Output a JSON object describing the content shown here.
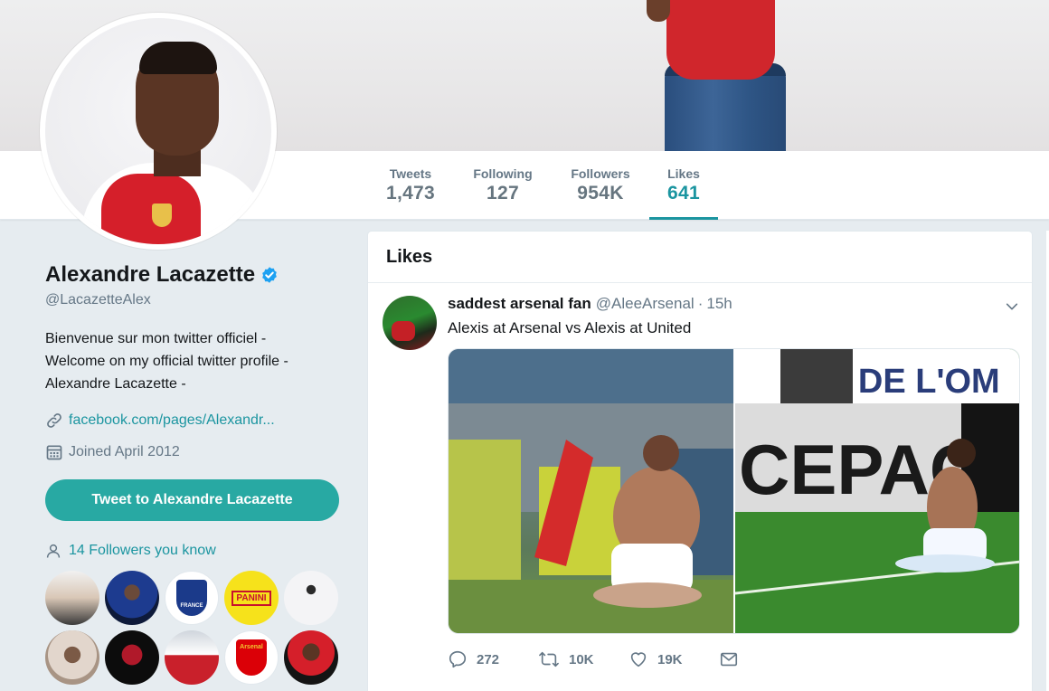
{
  "profile": {
    "name": "Alexandre Lacazette",
    "handle": "@LacazetteAlex",
    "bio": [
      "Bienvenue sur mon twitter officiel -",
      "Welcome on my official twitter profile -",
      "Alexandre Lacazette -"
    ],
    "link": "facebook.com/pages/Alexandr...",
    "joined": "Joined April 2012",
    "tweet_to_button": "Tweet to Alexandre Lacazette",
    "followers_you_know": "14 Followers you know"
  },
  "nav": {
    "stats": [
      {
        "label": "Tweets",
        "value": "1,473",
        "active": false
      },
      {
        "label": "Following",
        "value": "127",
        "active": false
      },
      {
        "label": "Followers",
        "value": "954K",
        "active": false
      },
      {
        "label": "Likes",
        "value": "641",
        "active": true
      }
    ]
  },
  "timeline": {
    "title": "Likes",
    "tweet": {
      "name": "saddest arsenal fan",
      "handle": "@AleeArsenal",
      "dot": "·",
      "time": "15h",
      "text": "Alexis at Arsenal vs Alexis at United",
      "image_banner_text": "S DE L'OM",
      "image_board_text": "CEPAC",
      "actions": {
        "replies": "272",
        "retweets": "10K",
        "likes": "19K"
      }
    }
  },
  "followers_grid": {
    "panini_text": "PANINI",
    "france_text": "FRANCE",
    "arsenal_text": "Arsenal"
  },
  "colors": {
    "accent": "#1b95a0",
    "button": "#28a9a3",
    "background": "#e6ecf0",
    "verified": "#1da1f2"
  },
  "icons": [
    "verified-badge-icon",
    "link-icon",
    "calendar-icon",
    "user-icon",
    "chevron-down-icon",
    "reply-icon",
    "retweet-icon",
    "like-icon",
    "message-icon"
  ]
}
